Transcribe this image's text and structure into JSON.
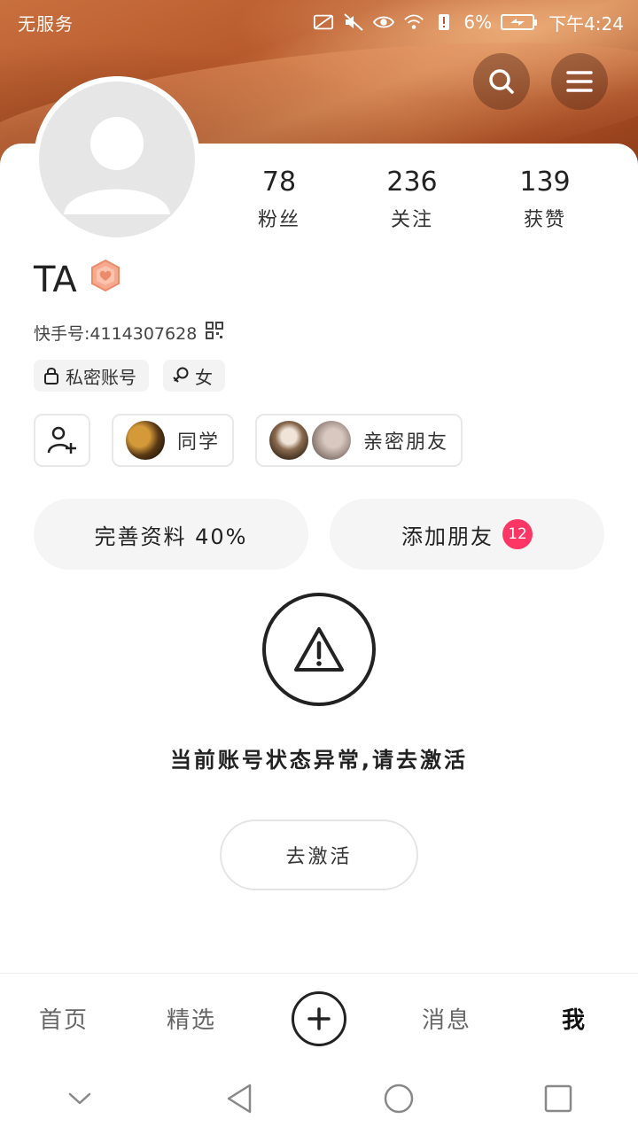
{
  "status_bar": {
    "carrier": "无服务",
    "battery_text": "6%",
    "time": "下午4:24"
  },
  "header": {
    "search_icon": "search-icon",
    "menu_icon": "menu-icon"
  },
  "profile": {
    "username": "TA",
    "kwai_id": "快手号:4114307628",
    "stats": [
      {
        "value": "78",
        "label": "粉丝"
      },
      {
        "value": "236",
        "label": "关注"
      },
      {
        "value": "139",
        "label": "获赞"
      }
    ],
    "tags": {
      "private": "私密账号",
      "gender": "女"
    },
    "relations": {
      "classmates": "同学",
      "close_friends": "亲密朋友"
    }
  },
  "actions": {
    "complete_profile": "完善资料 40%",
    "add_friends": "添加朋友",
    "add_friends_badge": "12"
  },
  "warning": {
    "message": "当前账号状态异常,请去激活",
    "button": "去激活"
  },
  "tabbar": {
    "home": "首页",
    "featured": "精选",
    "messages": "消息",
    "me": "我"
  },
  "colors": {
    "badge": "#fe3666",
    "banner": "#c9703f"
  }
}
